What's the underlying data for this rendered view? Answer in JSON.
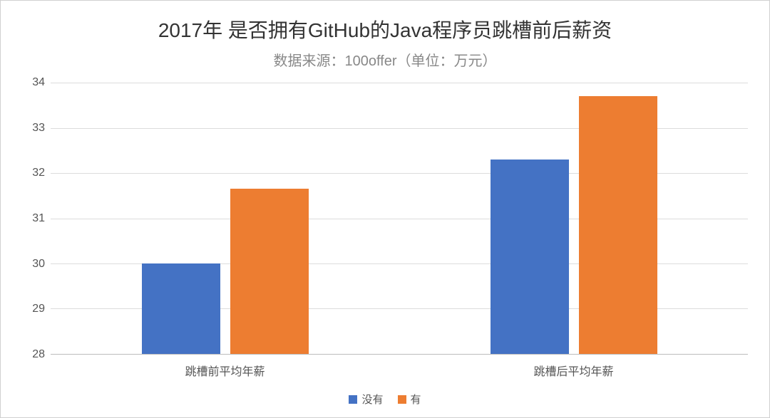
{
  "title": "2017年 是否拥有GitHub的Java程序员跳槽前后薪资",
  "subtitle": "数据来源：100offer（单位：万元）",
  "legend": {
    "series1": "没有",
    "series2": "有"
  },
  "xlabels": {
    "g1": "跳槽前平均年薪",
    "g2": "跳槽后平均年薪"
  },
  "yticks": {
    "t28": "28",
    "t29": "29",
    "t30": "30",
    "t31": "31",
    "t32": "32",
    "t33": "33",
    "t34": "34"
  },
  "chart_data": {
    "type": "bar",
    "title": "2017年 是否拥有GitHub的Java程序员跳槽前后薪资",
    "subtitle": "数据来源：100offer（单位：万元）",
    "xlabel": "",
    "ylabel": "",
    "ylim": [
      28,
      34
    ],
    "categories": [
      "跳槽前平均年薪",
      "跳槽后平均年薪"
    ],
    "series": [
      {
        "name": "没有",
        "color": "#4472C4",
        "values": [
          30.0,
          32.3
        ]
      },
      {
        "name": "有",
        "color": "#ED7D31",
        "values": [
          31.65,
          33.7
        ]
      }
    ],
    "legend_position": "bottom",
    "grid": true
  }
}
